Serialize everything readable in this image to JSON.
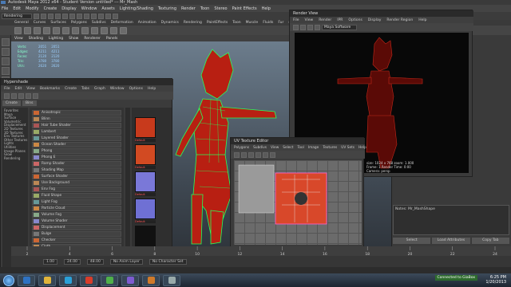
{
  "main": {
    "title": "Autodesk Maya 2012 x64 - Student Version untitled*  ---  Mr_Mash",
    "menu": [
      "File",
      "Edit",
      "Modify",
      "Create",
      "Display",
      "Window",
      "Assets",
      "Lighting/Shading",
      "Texturing",
      "Render",
      "Toon",
      "Stereo",
      "Paint Effects",
      "Help"
    ],
    "mode": "Rendering",
    "shelf_tabs": [
      "General",
      "Curves",
      "Surfaces",
      "Polygons",
      "Subdivs",
      "Deformation",
      "Animation",
      "Dynamics",
      "Rendering",
      "PaintEffects",
      "Toon",
      "Muscle",
      "Fluids",
      "Fur",
      "nHair",
      "nCloth",
      "Custom"
    ]
  },
  "viewport": {
    "menu": [
      "View",
      "Shading",
      "Lighting",
      "Show",
      "Renderer",
      "Panels"
    ],
    "hud": [
      {
        "label": "Verts:",
        "a": "2051",
        "b": "2051"
      },
      {
        "label": "Edges:",
        "a": "4211",
        "b": "4211"
      },
      {
        "label": "Faces:",
        "a": "2120",
        "b": "2120"
      },
      {
        "label": "Tris:",
        "a": "3780",
        "b": "3780"
      },
      {
        "label": "UVs:",
        "a": "2620",
        "b": "2620"
      }
    ]
  },
  "hypershade": {
    "title": "Hypershade",
    "menu": [
      "File",
      "Edit",
      "View",
      "Bookmarks",
      "Create",
      "Tabs",
      "Graph",
      "Window",
      "Options",
      "Help"
    ],
    "tabs": [
      "Create",
      "Bins"
    ],
    "tree": [
      "Favorites",
      "Maya",
      "Surface",
      "Volumetric",
      "Displacement",
      "2D Textures",
      "3D Textures",
      "Env Textures",
      "Other Textures",
      "Lights",
      "Utilities",
      "Image Planes",
      "Glow",
      "Rendering"
    ],
    "nodes": [
      "Anisotropic",
      "Blinn",
      "Hair Tube Shader",
      "Lambert",
      "Layered Shader",
      "Ocean Shader",
      "Phong",
      "Phong E",
      "Ramp Shader",
      "Shading Map",
      "Surface Shader",
      "Use Background",
      "Env Fog",
      "Fluid Shape",
      "Light Fog",
      "Particle Cloud",
      "Volume Fog",
      "Volume Shader",
      "Displacement",
      "Bulge",
      "Checker",
      "Cloth",
      "File",
      "Fluid Texture 2D",
      "Fractal"
    ],
    "swatch_label": "Default",
    "footer": "Work Area"
  },
  "renderview": {
    "title": "Render View",
    "menu": [
      "File",
      "View",
      "Render",
      "IPR",
      "Options",
      "Display",
      "Render Region",
      "Help"
    ],
    "renderer": "Maya Software",
    "info": [
      "size: 1024 x 768  zoom: 1.000",
      "Frame: 1   Render Time: 0:00",
      "Camera: persp"
    ]
  },
  "uveditor": {
    "title": "UV Texture Editor",
    "menu": [
      "Polygons",
      "Subdivs",
      "View",
      "Select",
      "Tool",
      "Image",
      "Textures",
      "UV Sets",
      "Help"
    ]
  },
  "attr": {
    "notes_label": "Notes: Mr_MashShape",
    "buttons": [
      "Select",
      "Load Attributes",
      "Copy Tab"
    ]
  },
  "timeline": {
    "start": "1.00",
    "end": "24.00",
    "range_end": "48.00",
    "anim_layer": "No Anim Layer",
    "char_set": "No Character Set",
    "ticks": [
      "2",
      "4",
      "6",
      "8",
      "10",
      "12",
      "14",
      "16",
      "18",
      "20",
      "22",
      "24"
    ]
  },
  "taskbar": {
    "time": "6:25 PM",
    "date": "1/20/2013",
    "message": "Connected to GiaBox"
  },
  "colors": {
    "wire": "#29ff5a",
    "body": "#b81f12",
    "accent": "#4a7ab3"
  }
}
